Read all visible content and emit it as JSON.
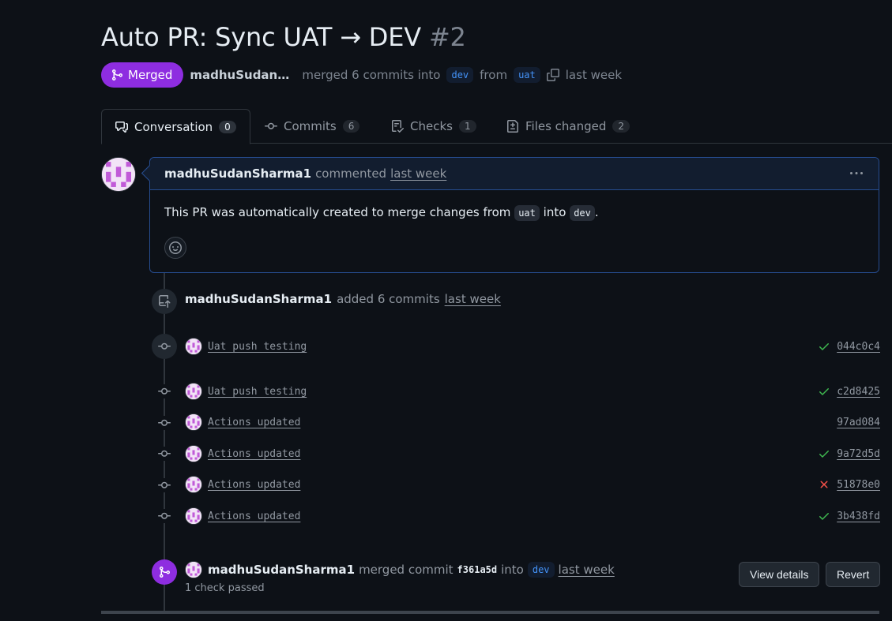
{
  "pr": {
    "title": "Auto PR: Sync UAT → DEV",
    "number": "#2",
    "state": "Merged",
    "author_truncated": "madhuSudanSh…",
    "merge_text": "merged 6 commits into",
    "base_branch": "dev",
    "from_text": "from",
    "head_branch": "uat",
    "when": "last week"
  },
  "tabs": [
    {
      "label": "Conversation",
      "count": "0",
      "icon": "comment-discussion-icon"
    },
    {
      "label": "Commits",
      "count": "6",
      "icon": "git-commit-icon"
    },
    {
      "label": "Checks",
      "count": "1",
      "icon": "checklist-icon"
    },
    {
      "label": "Files changed",
      "count": "2",
      "icon": "file-diff-icon"
    }
  ],
  "comment": {
    "author": "madhuSudanSharma1",
    "action": "commented",
    "when": "last week",
    "body_prefix": "This PR was automatically created to merge changes from",
    "body_from": "uat",
    "body_mid": "into",
    "body_to": "dev",
    "body_suffix": "."
  },
  "commits_event": {
    "author": "madhuSudanSharma1",
    "action": "added 6 commits",
    "when": "last week"
  },
  "commits": [
    {
      "message": "Uat push testing",
      "sha": "044c0c4",
      "status": "success"
    },
    {
      "message": "Uat push testing",
      "sha": "c2d8425",
      "status": "success"
    },
    {
      "message": "Actions updated",
      "sha": "97ad084",
      "status": "none"
    },
    {
      "message": "Actions updated",
      "sha": "9a72d5d",
      "status": "success"
    },
    {
      "message": "Actions updated",
      "sha": "51878e0",
      "status": "failure"
    },
    {
      "message": "Actions updated",
      "sha": "3b438fd",
      "status": "success"
    }
  ],
  "merge_event": {
    "author": "madhuSudanSharma1",
    "action": "merged commit",
    "sha": "f361a5d",
    "into": "into",
    "branch": "dev",
    "when": "last week",
    "checks": "1 check passed",
    "view_details_label": "View details",
    "revert_label": "Revert"
  },
  "colors": {
    "background": "#0d1117",
    "merged": "#8e2de0",
    "success": "#3fb950",
    "failure": "#f85149",
    "link_blue": "#4493f8"
  }
}
